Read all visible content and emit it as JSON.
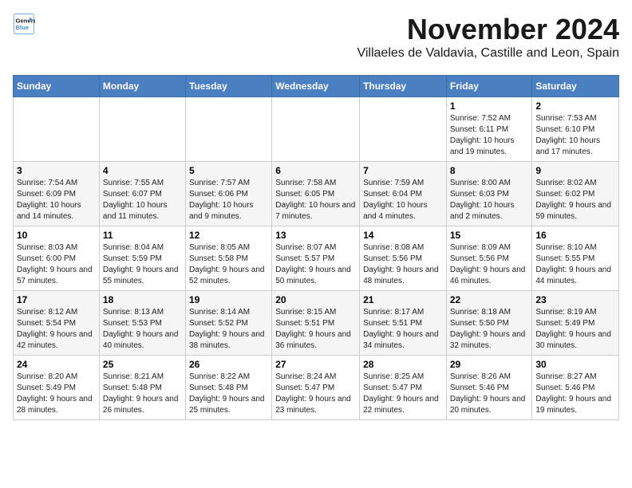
{
  "logo": {
    "line1": "General",
    "line2": "Blue"
  },
  "title": "November 2024",
  "location": "Villaeles de Valdavia, Castille and Leon, Spain",
  "weekdays": [
    "Sunday",
    "Monday",
    "Tuesday",
    "Wednesday",
    "Thursday",
    "Friday",
    "Saturday"
  ],
  "weeks": [
    [
      {
        "day": "",
        "info": ""
      },
      {
        "day": "",
        "info": ""
      },
      {
        "day": "",
        "info": ""
      },
      {
        "day": "",
        "info": ""
      },
      {
        "day": "",
        "info": ""
      },
      {
        "day": "1",
        "info": "Sunrise: 7:52 AM\nSunset: 6:11 PM\nDaylight: 10 hours and 19 minutes."
      },
      {
        "day": "2",
        "info": "Sunrise: 7:53 AM\nSunset: 6:10 PM\nDaylight: 10 hours and 17 minutes."
      }
    ],
    [
      {
        "day": "3",
        "info": "Sunrise: 7:54 AM\nSunset: 6:09 PM\nDaylight: 10 hours and 14 minutes."
      },
      {
        "day": "4",
        "info": "Sunrise: 7:55 AM\nSunset: 6:07 PM\nDaylight: 10 hours and 11 minutes."
      },
      {
        "day": "5",
        "info": "Sunrise: 7:57 AM\nSunset: 6:06 PM\nDaylight: 10 hours and 9 minutes."
      },
      {
        "day": "6",
        "info": "Sunrise: 7:58 AM\nSunset: 6:05 PM\nDaylight: 10 hours and 7 minutes."
      },
      {
        "day": "7",
        "info": "Sunrise: 7:59 AM\nSunset: 6:04 PM\nDaylight: 10 hours and 4 minutes."
      },
      {
        "day": "8",
        "info": "Sunrise: 8:00 AM\nSunset: 6:03 PM\nDaylight: 10 hours and 2 minutes."
      },
      {
        "day": "9",
        "info": "Sunrise: 8:02 AM\nSunset: 6:02 PM\nDaylight: 9 hours and 59 minutes."
      }
    ],
    [
      {
        "day": "10",
        "info": "Sunrise: 8:03 AM\nSunset: 6:00 PM\nDaylight: 9 hours and 57 minutes."
      },
      {
        "day": "11",
        "info": "Sunrise: 8:04 AM\nSunset: 5:59 PM\nDaylight: 9 hours and 55 minutes."
      },
      {
        "day": "12",
        "info": "Sunrise: 8:05 AM\nSunset: 5:58 PM\nDaylight: 9 hours and 52 minutes."
      },
      {
        "day": "13",
        "info": "Sunrise: 8:07 AM\nSunset: 5:57 PM\nDaylight: 9 hours and 50 minutes."
      },
      {
        "day": "14",
        "info": "Sunrise: 8:08 AM\nSunset: 5:56 PM\nDaylight: 9 hours and 48 minutes."
      },
      {
        "day": "15",
        "info": "Sunrise: 8:09 AM\nSunset: 5:56 PM\nDaylight: 9 hours and 46 minutes."
      },
      {
        "day": "16",
        "info": "Sunrise: 8:10 AM\nSunset: 5:55 PM\nDaylight: 9 hours and 44 minutes."
      }
    ],
    [
      {
        "day": "17",
        "info": "Sunrise: 8:12 AM\nSunset: 5:54 PM\nDaylight: 9 hours and 42 minutes."
      },
      {
        "day": "18",
        "info": "Sunrise: 8:13 AM\nSunset: 5:53 PM\nDaylight: 9 hours and 40 minutes."
      },
      {
        "day": "19",
        "info": "Sunrise: 8:14 AM\nSunset: 5:52 PM\nDaylight: 9 hours and 38 minutes."
      },
      {
        "day": "20",
        "info": "Sunrise: 8:15 AM\nSunset: 5:51 PM\nDaylight: 9 hours and 36 minutes."
      },
      {
        "day": "21",
        "info": "Sunrise: 8:17 AM\nSunset: 5:51 PM\nDaylight: 9 hours and 34 minutes."
      },
      {
        "day": "22",
        "info": "Sunrise: 8:18 AM\nSunset: 5:50 PM\nDaylight: 9 hours and 32 minutes."
      },
      {
        "day": "23",
        "info": "Sunrise: 8:19 AM\nSunset: 5:49 PM\nDaylight: 9 hours and 30 minutes."
      }
    ],
    [
      {
        "day": "24",
        "info": "Sunrise: 8:20 AM\nSunset: 5:49 PM\nDaylight: 9 hours and 28 minutes."
      },
      {
        "day": "25",
        "info": "Sunrise: 8:21 AM\nSunset: 5:48 PM\nDaylight: 9 hours and 26 minutes."
      },
      {
        "day": "26",
        "info": "Sunrise: 8:22 AM\nSunset: 5:48 PM\nDaylight: 9 hours and 25 minutes."
      },
      {
        "day": "27",
        "info": "Sunrise: 8:24 AM\nSunset: 5:47 PM\nDaylight: 9 hours and 23 minutes."
      },
      {
        "day": "28",
        "info": "Sunrise: 8:25 AM\nSunset: 5:47 PM\nDaylight: 9 hours and 22 minutes."
      },
      {
        "day": "29",
        "info": "Sunrise: 8:26 AM\nSunset: 5:46 PM\nDaylight: 9 hours and 20 minutes."
      },
      {
        "day": "30",
        "info": "Sunrise: 8:27 AM\nSunset: 5:46 PM\nDaylight: 9 hours and 19 minutes."
      }
    ]
  ]
}
